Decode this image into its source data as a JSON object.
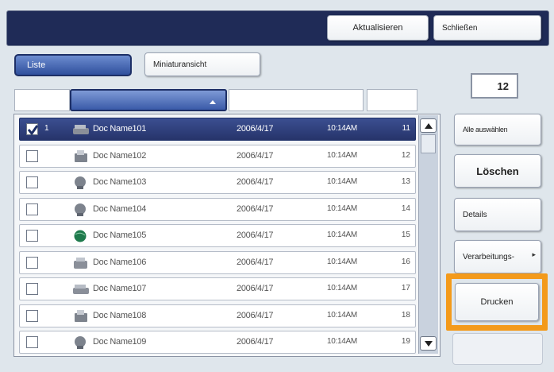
{
  "header": {
    "refresh_label": "Aktualisieren",
    "close_label": "Schließen"
  },
  "view_tabs": {
    "list_label": "Liste",
    "thumbnail_label": "Miniaturansicht"
  },
  "document_count": "12",
  "documents": [
    {
      "num": "1",
      "name": "Doc Name101",
      "date": "2006/4/17",
      "time": "10:14AM",
      "id": "11",
      "checked": true,
      "selected": true,
      "icon": "scanner-icon"
    },
    {
      "num": "",
      "name": "Doc Name102",
      "date": "2006/4/17",
      "time": "10:14AM",
      "id": "12",
      "checked": false,
      "selected": false,
      "icon": "fax-icon"
    },
    {
      "num": "",
      "name": "Doc Name103",
      "date": "2006/4/17",
      "time": "10:14AM",
      "id": "13",
      "checked": false,
      "selected": false,
      "icon": "computer-icon"
    },
    {
      "num": "",
      "name": "Doc Name104",
      "date": "2006/4/17",
      "time": "10:14AM",
      "id": "14",
      "checked": false,
      "selected": false,
      "icon": "computer-icon"
    },
    {
      "num": "",
      "name": "Doc Name105",
      "date": "2006/4/17",
      "time": "10:14AM",
      "id": "15",
      "checked": false,
      "selected": false,
      "icon": "globe-icon"
    },
    {
      "num": "",
      "name": "Doc Name106",
      "date": "2006/4/17",
      "time": "10:14AM",
      "id": "16",
      "checked": false,
      "selected": false,
      "icon": "copier-icon"
    },
    {
      "num": "",
      "name": "Doc Name107",
      "date": "2006/4/17",
      "time": "10:14AM",
      "id": "17",
      "checked": false,
      "selected": false,
      "icon": "scanner-icon"
    },
    {
      "num": "",
      "name": "Doc Name108",
      "date": "2006/4/17",
      "time": "10:14AM",
      "id": "18",
      "checked": false,
      "selected": false,
      "icon": "fax-icon"
    },
    {
      "num": "",
      "name": "Doc Name109",
      "date": "2006/4/17",
      "time": "10:14AM",
      "id": "19",
      "checked": false,
      "selected": false,
      "icon": "computer-icon"
    }
  ],
  "actions": {
    "select_all_label": "Alle auswählen",
    "delete_label": "Löschen",
    "details_label": "Details",
    "processing_label": "Verarbeitungs-",
    "print_label": "Drucken"
  },
  "colors": {
    "header_bg": "#1f2b57",
    "selected_row": "#2c3b77",
    "tab_active": "#3a5aa8",
    "highlight": "#f39a1b",
    "panel_bg": "#dfe6ec"
  }
}
